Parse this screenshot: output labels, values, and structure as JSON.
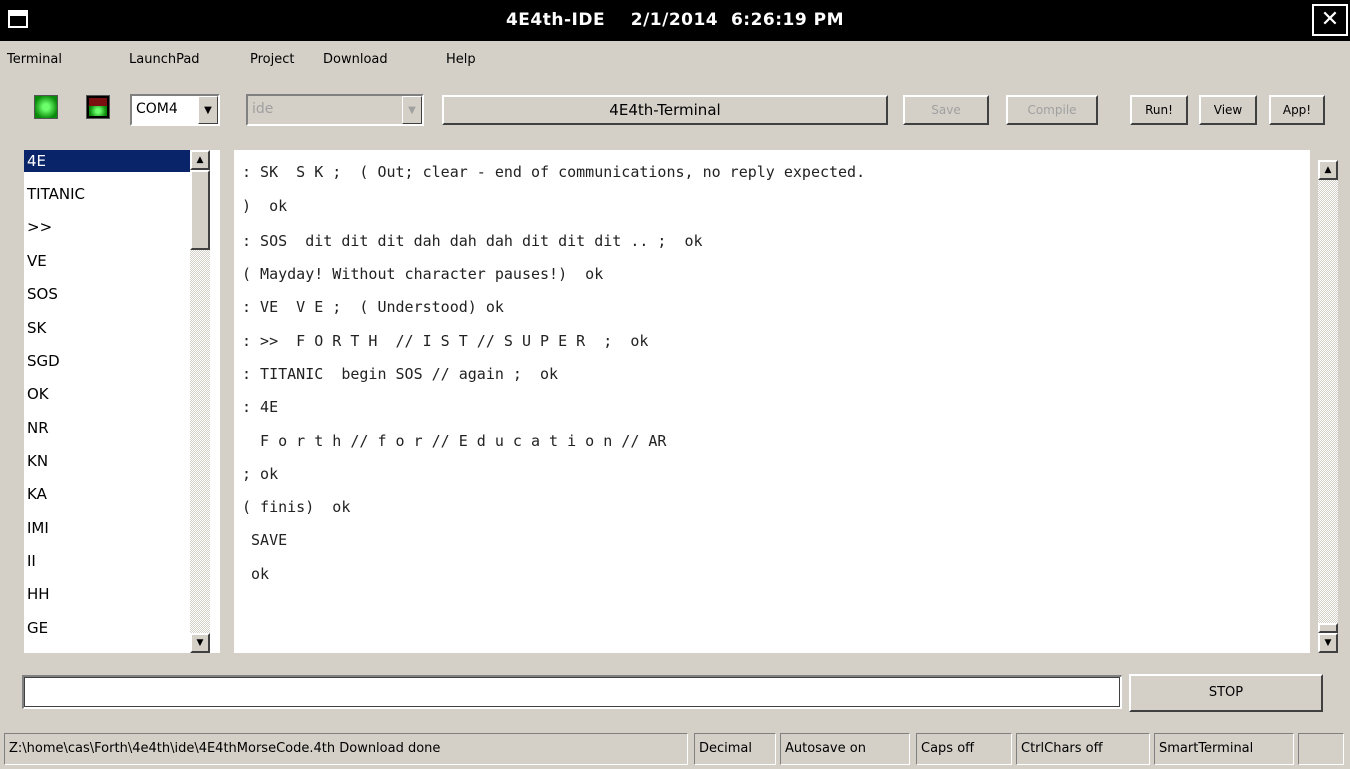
{
  "window": {
    "title": "4E4th-IDE    2/1/2014  6:26:19 PM",
    "close_glyph": "✕"
  },
  "menu": [
    "Terminal",
    "LaunchPad",
    "Project",
    "Download",
    "Help"
  ],
  "toolbar": {
    "port": "COM4",
    "mode": "ide",
    "terminal_button": "4E4th-Terminal",
    "save": "Save",
    "compile": "Compile",
    "run": "Run!",
    "view": "View",
    "app": "App!"
  },
  "words": [
    "4E",
    "TITANIC",
    ">>",
    "VE",
    "SOS",
    "SK",
    "SGD",
    "OK",
    "NR",
    "KN",
    "KA",
    "IMI",
    "II",
    "HH",
    "GE"
  ],
  "selected_word": "4E",
  "terminal_lines": [
    ": SK  S K ;  ( Out; clear - end of communications, no reply expected.",
    ")  ok",
    ": SOS  dit dit dit dah dah dah dit dit dit .. ;  ok",
    "( Mayday! Without character pauses!)  ok",
    ": VE  V E ;  ( Understood) ok",
    ": >>  F O R T H  // I S T // S U P E R  ;  ok",
    ": TITANIC  begin SOS // again ;  ok",
    ": 4E",
    "  F o r t h // f o r // E d u c a t i o n // AR",
    "; ok",
    "( finis)  ok",
    " SAVE",
    " ok"
  ],
  "command_input": "",
  "stop_button": "STOP",
  "status": {
    "message": "Z:\\home\\cas\\Forth\\4e4th\\ide\\4E4thMorseCode.4th Download done",
    "base": "Decimal",
    "autosave": "Autosave on",
    "caps": "Caps off",
    "ctrlchars": "CtrlChars off",
    "terminal_mode": "SmartTerminal",
    "extra": ""
  },
  "icons": {
    "scroll_up": "▲",
    "scroll_down": "▼",
    "dropdown": "▼"
  },
  "colors": {
    "selection": "#0a246a",
    "titlebar": "#000000",
    "face": "#d4d0c8"
  }
}
